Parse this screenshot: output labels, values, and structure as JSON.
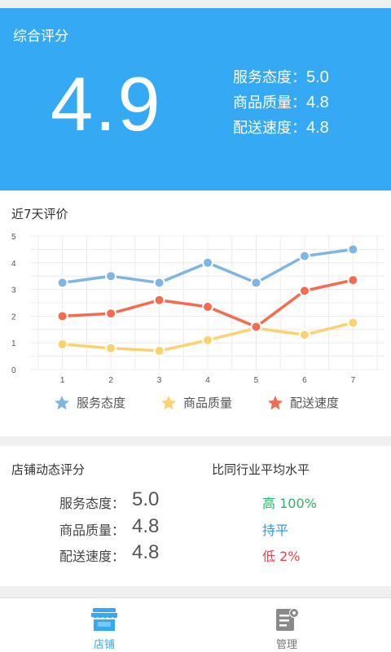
{
  "header": {
    "title": "综合评分",
    "score": "4.9",
    "lines": [
      {
        "label": "服务态度：",
        "value": "5.0"
      },
      {
        "label": "商品质量：",
        "value": "4.8"
      },
      {
        "label": "配送速度：",
        "value": "4.8"
      }
    ]
  },
  "chart_section": {
    "title": "近7天评价"
  },
  "chart_data": {
    "type": "line",
    "x": [
      1,
      2,
      3,
      4,
      5,
      6,
      7
    ],
    "ylim": [
      0,
      5
    ],
    "yticks": [
      0,
      1,
      2,
      3,
      4,
      5
    ],
    "grid": true,
    "legend_position": "bottom",
    "series": [
      {
        "name": "服务态度",
        "color": "#7db6e3",
        "values": [
          3.25,
          3.5,
          3.25,
          4.0,
          3.25,
          4.25,
          4.5
        ]
      },
      {
        "name": "商品质量",
        "color": "#fdd26e",
        "values": [
          0.95,
          0.8,
          0.7,
          1.1,
          1.55,
          1.3,
          1.75
        ]
      },
      {
        "name": "配送速度",
        "color": "#f46b4f",
        "values": [
          2.0,
          2.1,
          2.6,
          2.35,
          1.6,
          2.95,
          3.35
        ]
      }
    ]
  },
  "dynamic": {
    "title": "店铺动态评分",
    "compare_title": "比同行业平均水平",
    "rows": [
      {
        "label": "服务态度：",
        "value": "5.0",
        "compare": "高 100%",
        "compare_color": "#25b865"
      },
      {
        "label": "商品质量：",
        "value": "4.8",
        "compare": "持平",
        "compare_color": "#2c9af0"
      },
      {
        "label": "配送速度：",
        "value": "4.8",
        "compare": "低 2%",
        "compare_color": "#e9424f"
      }
    ]
  },
  "nav": {
    "items": [
      {
        "label": "店铺",
        "icon": "store-icon",
        "active": true,
        "color": "#36a9f5"
      },
      {
        "label": "管理",
        "icon": "document-settings-icon",
        "active": false,
        "color": "#777777"
      }
    ]
  },
  "colors": {
    "primary": "#36a9f5",
    "background": "#f0f0f0"
  }
}
